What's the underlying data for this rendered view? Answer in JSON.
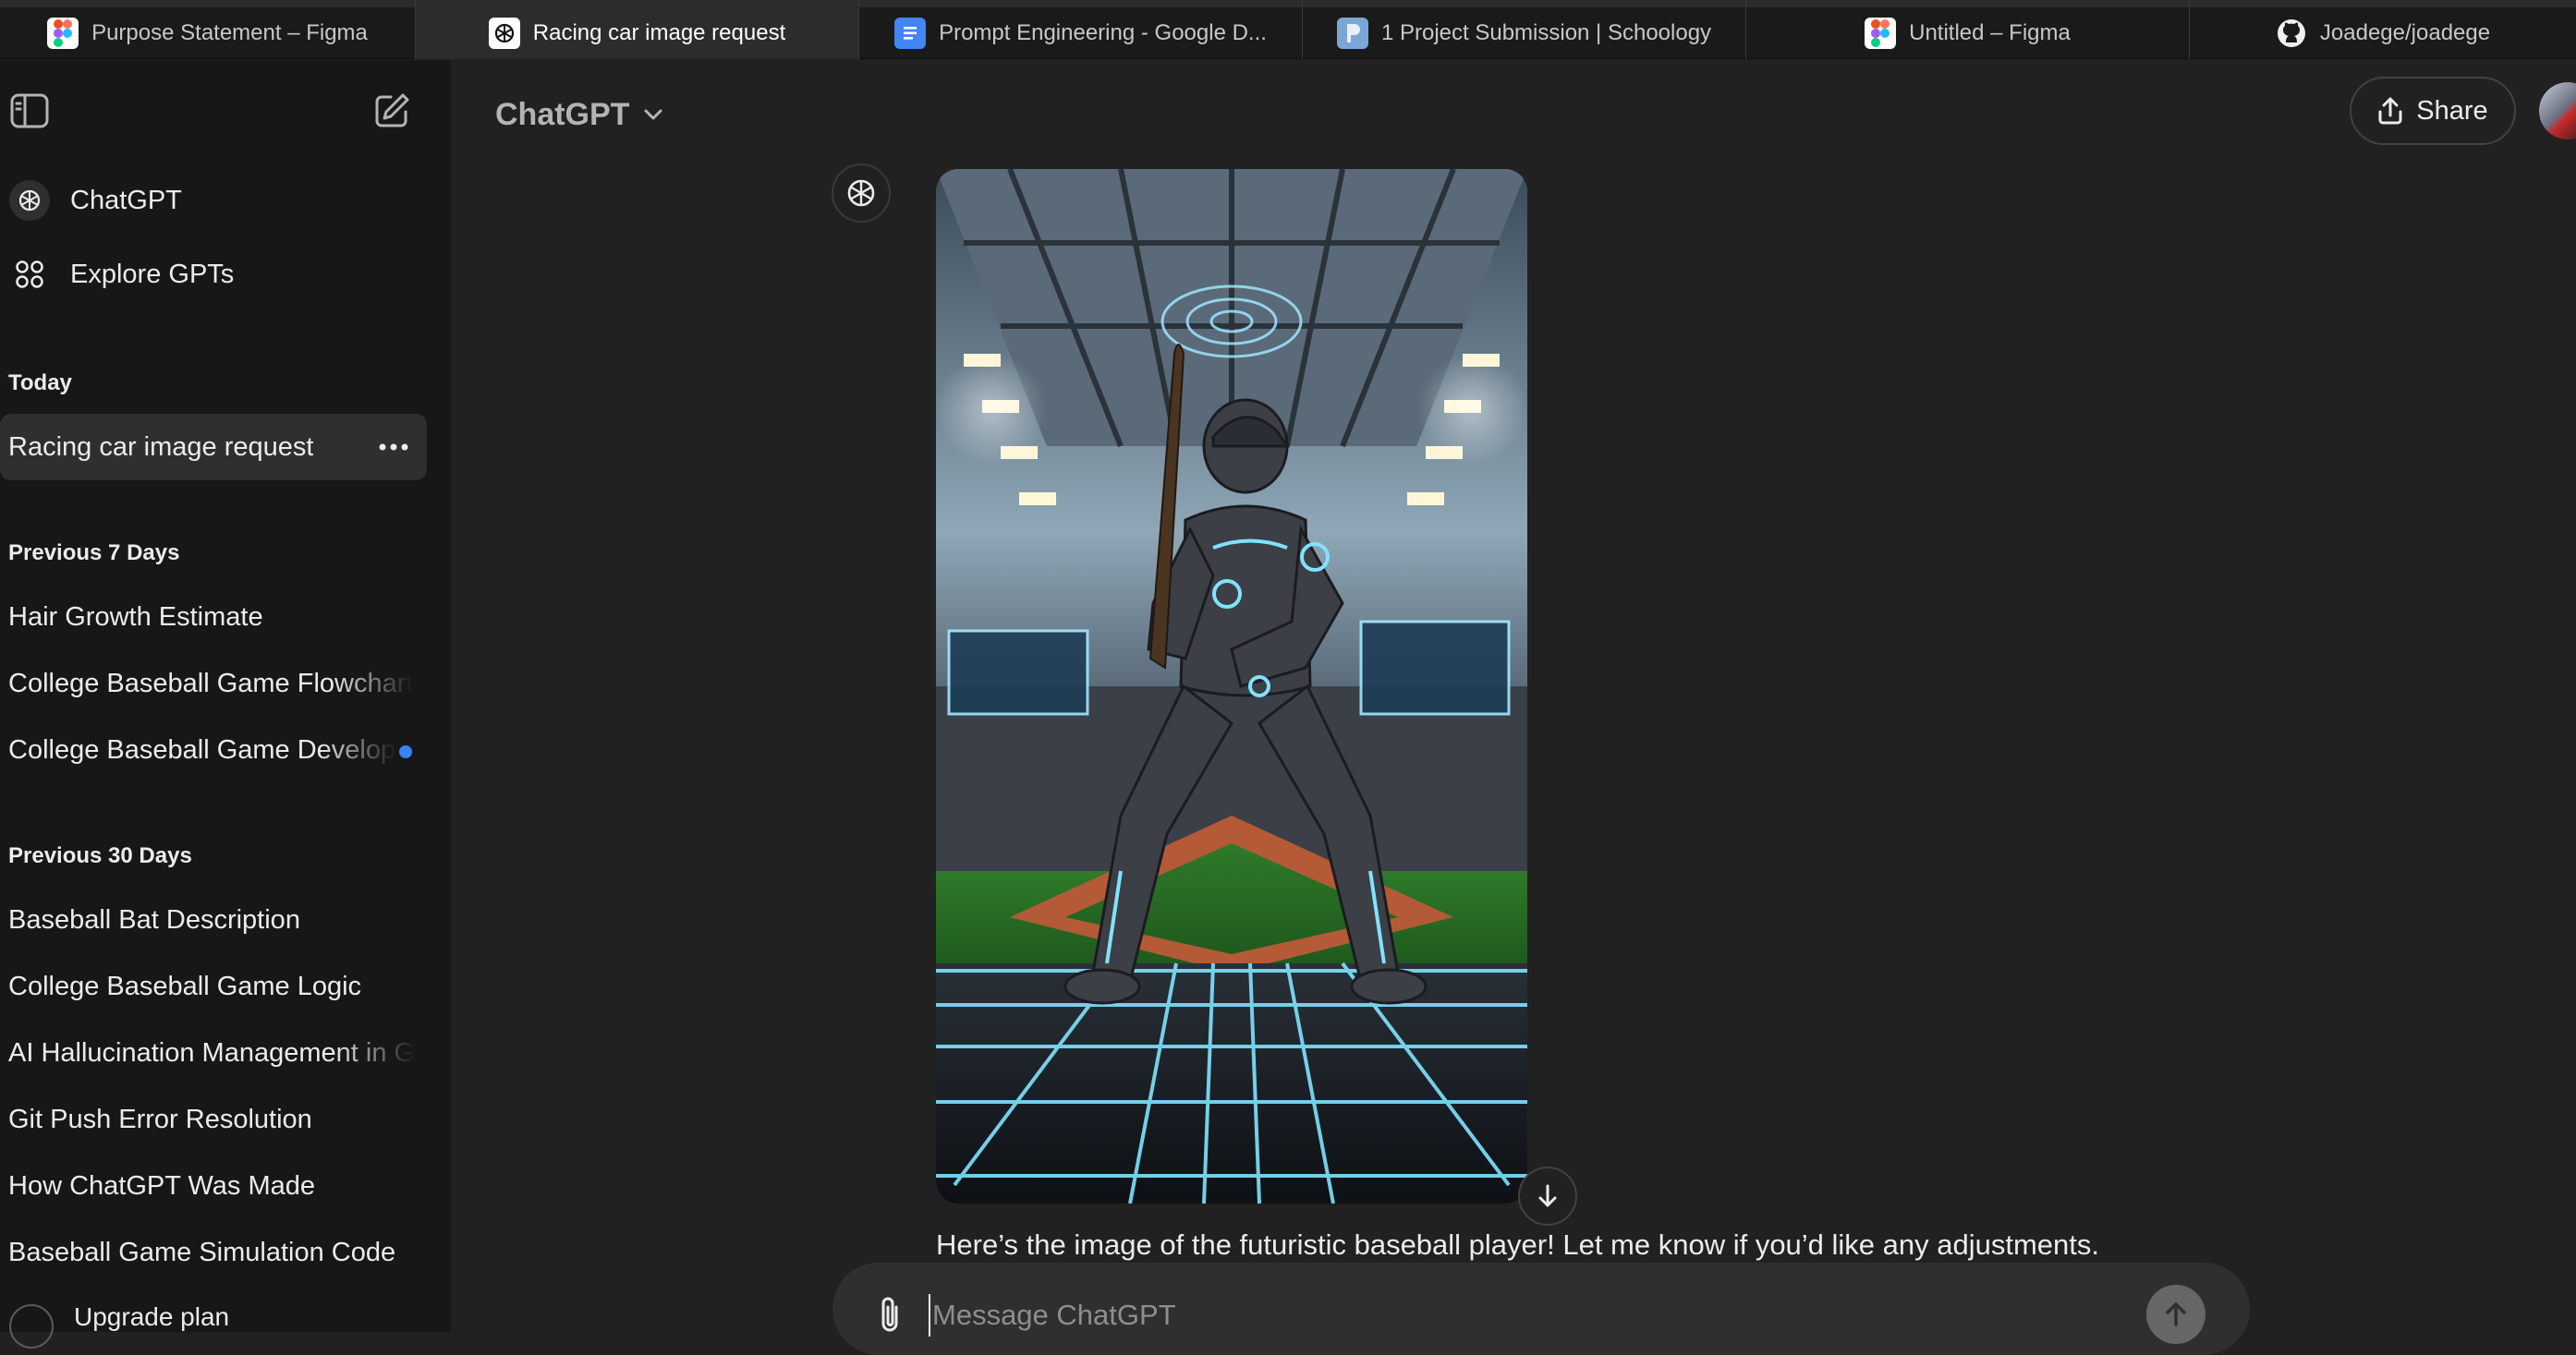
{
  "browser": {
    "tabs": [
      {
        "label": "Purpose Statement – Figma",
        "icon": "figma-icon",
        "active": false
      },
      {
        "label": "Racing car image request",
        "icon": "chatgpt-icon",
        "active": true
      },
      {
        "label": "Prompt Engineering - Google D...",
        "icon": "google-docs-icon",
        "active": false
      },
      {
        "label": "1 Project Submission | Schoology",
        "icon": "schoology-icon",
        "active": false
      },
      {
        "label": "Untitled – Figma",
        "icon": "figma-icon",
        "active": false
      },
      {
        "label": "Joadege/joadege",
        "icon": "github-icon",
        "active": false
      }
    ]
  },
  "sidebar": {
    "nav": [
      {
        "label": "ChatGPT",
        "icon": "chatgpt-icon"
      },
      {
        "label": "Explore GPTs",
        "icon": "grid-icon"
      }
    ],
    "sections": [
      {
        "title": "Today",
        "items": [
          "Racing car image request"
        ]
      },
      {
        "title": "Previous 7 Days",
        "items": [
          "Hair Growth Estimate",
          "College Baseball Game Flowchart",
          "College Baseball Game Development"
        ]
      },
      {
        "title": "Previous 30 Days",
        "items": [
          "Baseball Bat Description",
          "College Baseball Game Logic",
          "AI Hallucination Management in Games",
          "Git Push Error Resolution",
          "How ChatGPT Was Made",
          "Baseball Game Simulation Code"
        ]
      }
    ],
    "upgrade_label": "Upgrade plan"
  },
  "header": {
    "model": "ChatGPT",
    "share_label": "Share"
  },
  "conversation": {
    "image_alt": "Futuristic baseball player in a stadium",
    "reply": "Here’s the image of the futuristic baseball player! Let me know if you’d like any adjustments."
  },
  "composer": {
    "placeholder": "Message ChatGPT"
  },
  "colors": {
    "accent_unread": "#3a82f7",
    "sidebar_bg": "#171717",
    "main_bg": "#212121"
  }
}
